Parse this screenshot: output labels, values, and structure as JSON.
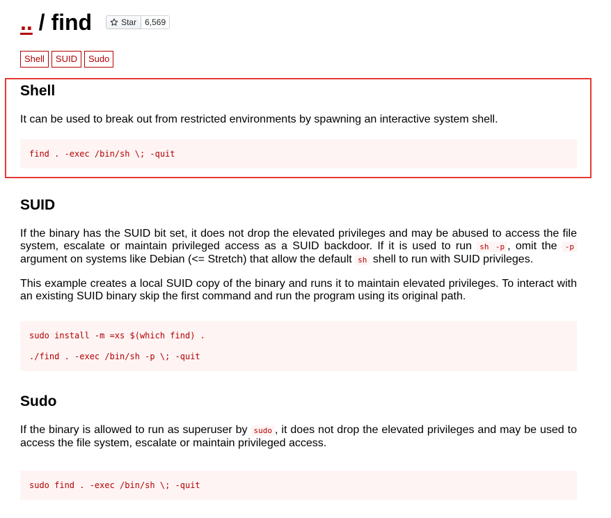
{
  "header": {
    "up_link": "..",
    "separator": " / ",
    "binary_name": "find",
    "star_label": "Star",
    "star_count": "6,569"
  },
  "tags": [
    "Shell",
    "SUID",
    "Sudo"
  ],
  "sections": {
    "shell": {
      "heading": "Shell",
      "description": "It can be used to break out from restricted environments by spawning an interactive system shell.",
      "code": [
        "find . -exec /bin/sh \\; -quit"
      ]
    },
    "suid": {
      "heading": "SUID",
      "p1": {
        "t1": "If the binary has the SUID bit set, it does not drop the elevated privileges and may be abused to access the file system, escalate or maintain privileged access as a SUID backdoor. If it is used to run ",
        "c1": "sh -p",
        "t2": ", omit the ",
        "c2": "-p",
        "t3": " argument on systems like Debian (<= Stretch) that allow the default ",
        "c3": "sh",
        "t4": " shell to run with SUID privileges."
      },
      "p2": "This example creates a local SUID copy of the binary and runs it to maintain elevated privileges. To interact with an existing SUID binary skip the first command and run the program using its original path.",
      "code": [
        "sudo install -m =xs $(which find) .",
        "./find . -exec /bin/sh -p \\; -quit"
      ]
    },
    "sudo": {
      "heading": "Sudo",
      "p1": {
        "t1": "If the binary is allowed to run as superuser by ",
        "c1": "sudo",
        "t2": ", it does not drop the elevated privileges and may be used to access the file system, escalate or maintain privileged access."
      },
      "code": [
        "sudo find . -exec /bin/sh \\; -quit"
      ]
    }
  },
  "colors": {
    "accent": "#b30000",
    "code_bg": "#fff4f4",
    "highlight_border": "#e53935"
  }
}
